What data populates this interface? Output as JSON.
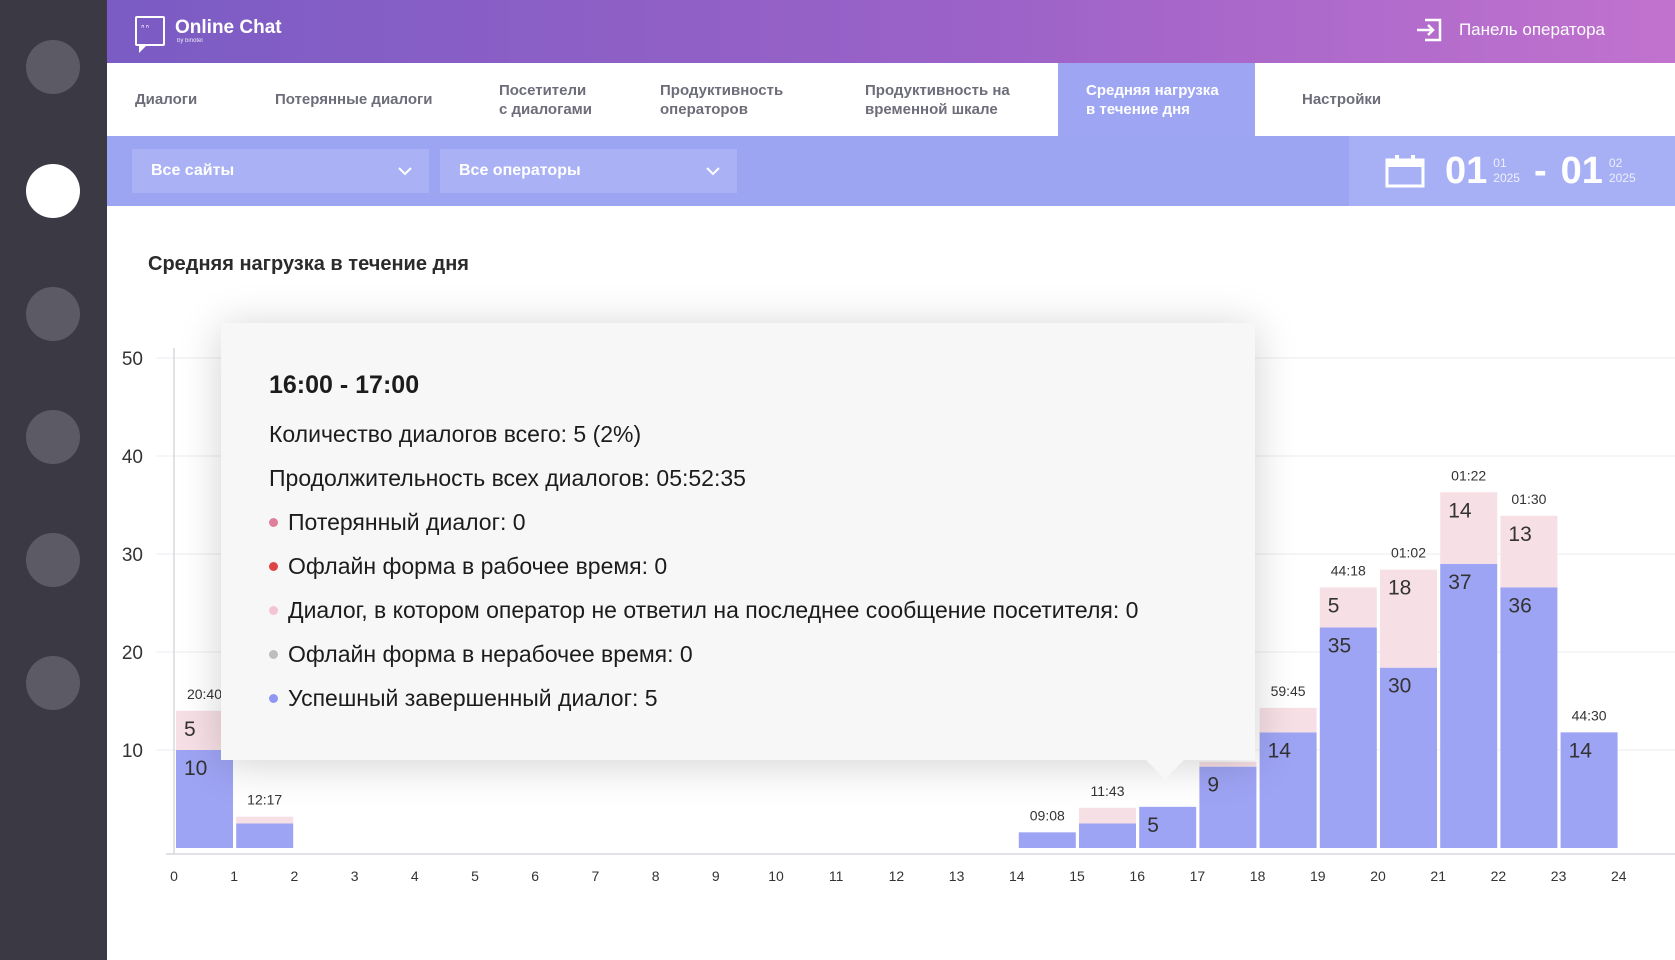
{
  "header": {
    "brand": "Online Chat",
    "brand_sub": "by binotel",
    "operator_panel": "Панель оператора"
  },
  "tabs": [
    {
      "label": "Диалоги",
      "active": false
    },
    {
      "label": "Потерянные диалоги",
      "active": false
    },
    {
      "label": "Посетители\nс диалогами",
      "active": false
    },
    {
      "label": "Продуктивность\nоператоров",
      "active": false
    },
    {
      "label": "Продуктивность на\nвременной шкале",
      "active": false
    },
    {
      "label": "Средняя нагрузка\nв течение дня",
      "active": true
    },
    {
      "label": "Настройки",
      "active": false
    }
  ],
  "filters": {
    "sites": "Все сайты",
    "operators": "Все операторы"
  },
  "date_range": {
    "from_day": "01",
    "from_month": "01",
    "from_year": "2025",
    "separator": "-",
    "to_day": "01",
    "to_month": "02",
    "to_year": "2025"
  },
  "chart_title": "Средняя нагрузка в течение дня",
  "chart_data": {
    "type": "bar",
    "title": "Средняя нагрузка в течение дня",
    "x_ticks": [
      "0",
      "1",
      "2",
      "3",
      "4",
      "5",
      "6",
      "7",
      "8",
      "9",
      "10",
      "11",
      "12",
      "13",
      "14",
      "15",
      "16",
      "17",
      "18",
      "19",
      "20",
      "21",
      "22",
      "23",
      "24"
    ],
    "y_ticks": [
      10,
      20,
      30,
      40,
      50
    ],
    "ylim": [
      0,
      50
    ],
    "grid": true,
    "bars": [
      {
        "hour": 0,
        "success": 10,
        "pink": 4,
        "success_label": "10",
        "pink_label": "5",
        "top_label": "20:40"
      },
      {
        "hour": 1,
        "success": 2.5,
        "pink": 0.7,
        "success_label": "",
        "pink_label": "",
        "top_label": "12:17"
      },
      {
        "hour": 14,
        "success": 1.6,
        "pink": 0,
        "success_label": "",
        "pink_label": "",
        "top_label": "09:08"
      },
      {
        "hour": 15,
        "success": 2.5,
        "pink": 1.6,
        "success_label": "",
        "pink_label": "",
        "top_label": "11:43"
      },
      {
        "hour": 16,
        "success": 4.2,
        "pink": 0,
        "success_label": "5",
        "pink_label": "",
        "top_label": ""
      },
      {
        "hour": 17,
        "success": 8.3,
        "pink": 0.5,
        "success_label": "9",
        "pink_label": "",
        "top_label": ""
      },
      {
        "hour": 18,
        "success": 11.8,
        "pink": 2.5,
        "success_label": "14",
        "pink_label": "",
        "top_label": "59:45"
      },
      {
        "hour": 19,
        "success": 22.5,
        "pink": 4.1,
        "success_label": "35",
        "pink_label": "5",
        "top_label": "44:18"
      },
      {
        "hour": 20,
        "success": 18.4,
        "pink": 10,
        "success_label": "30",
        "pink_label": "18",
        "top_label": "01:02"
      },
      {
        "hour": 21,
        "success": 29,
        "pink": 7.3,
        "success_label": "37",
        "pink_label": "14",
        "top_label": "01:22"
      },
      {
        "hour": 22,
        "success": 26.6,
        "pink": 7.3,
        "success_label": "36",
        "pink_label": "13",
        "top_label": "01:30"
      },
      {
        "hour": 23,
        "success": 11.8,
        "pink": 0,
        "success_label": "14",
        "pink_label": "",
        "top_label": "44:30"
      }
    ],
    "colors": {
      "success": "#9ea4f4",
      "pink": "#f6dfe5",
      "grid": "#ececf0",
      "axis": "#d8d8de"
    }
  },
  "tooltip": {
    "title": "16:00 - 17:00",
    "total": "Количество диалогов всего: 5 (2%)",
    "duration": "Продолжительность всех диалогов: 05:52:35",
    "items": [
      {
        "label": "Потерянный диалог: 0",
        "color": "#e07f9c"
      },
      {
        "label": "Офлайн форма в рабочее время: 0",
        "color": "#e04545"
      },
      {
        "label": "Диалог, в котором оператор не ответил на последнее сообщение посетителя: 0",
        "color": "#f4c4d2"
      },
      {
        "label": "Офлайн форма в нерабочее время: 0",
        "color": "#bdbdbd"
      },
      {
        "label": "Успешный завершенный диалог: 5",
        "color": "#8f97f2"
      }
    ]
  }
}
